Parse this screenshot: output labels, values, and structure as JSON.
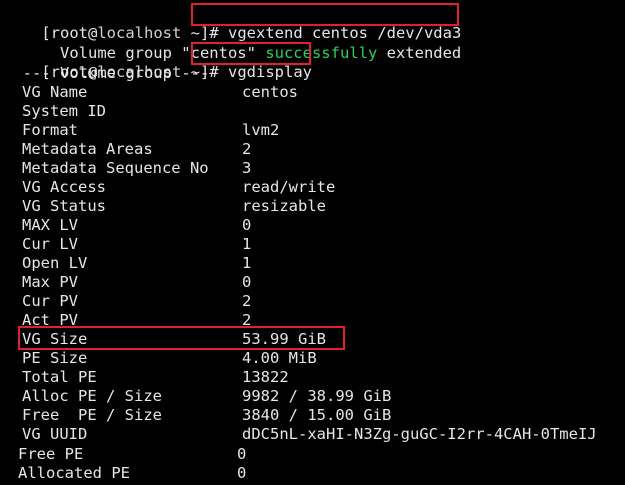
{
  "prompt1": {
    "prefix": "[root@",
    "host": "localhost",
    "suffix": " ~]# ",
    "command": "vgextend centos /dev/vda3"
  },
  "output1": {
    "before": "  Volume group \"centos\" ",
    "status": "successfully",
    "after": " extended"
  },
  "prompt2": {
    "prefix": "[root@",
    "host": "localhost",
    "suffix": " ~]# ",
    "command": "vgdisplay"
  },
  "section_header": "  --- Volume group ---",
  "fields": [
    {
      "key": "VG Name",
      "value": "centos"
    },
    {
      "key": "System ID",
      "value": ""
    },
    {
      "key": "Format",
      "value": "lvm2"
    },
    {
      "key": "Metadata Areas",
      "value": "2"
    },
    {
      "key": "Metadata Sequence No",
      "value": "3"
    },
    {
      "key": "VG Access",
      "value": "read/write"
    },
    {
      "key": "VG Status",
      "value": "resizable"
    },
    {
      "key": "MAX LV",
      "value": "0"
    },
    {
      "key": "Cur LV",
      "value": "1"
    },
    {
      "key": "Open LV",
      "value": "1"
    },
    {
      "key": "Max PV",
      "value": "0"
    },
    {
      "key": "Cur PV",
      "value": "2"
    },
    {
      "key": "Act PV",
      "value": "2"
    },
    {
      "key": "VG Size",
      "value": "53.99 GiB"
    },
    {
      "key": "PE Size",
      "value": "4.00 MiB"
    },
    {
      "key": "Total PE",
      "value": "13822"
    },
    {
      "key": "Alloc PE / Size",
      "value": "9982 / 38.99 GiB"
    },
    {
      "key": "Free  PE / Size",
      "value": "3840 / 15.00 GiB"
    },
    {
      "key": "VG UUID",
      "value": "dDC5nL-xaHI-N3Zg-guGC-I2rr-4CAH-0TmeIJ"
    }
  ],
  "fragments": [
    {
      "key": "Free PE",
      "value": "0"
    },
    {
      "key": "Allocated PE",
      "value": "0"
    }
  ],
  "colors": {
    "background": "#000000",
    "text": "#e6e6e6",
    "success": "#26d35a",
    "highlight_box": "#e0202a"
  }
}
